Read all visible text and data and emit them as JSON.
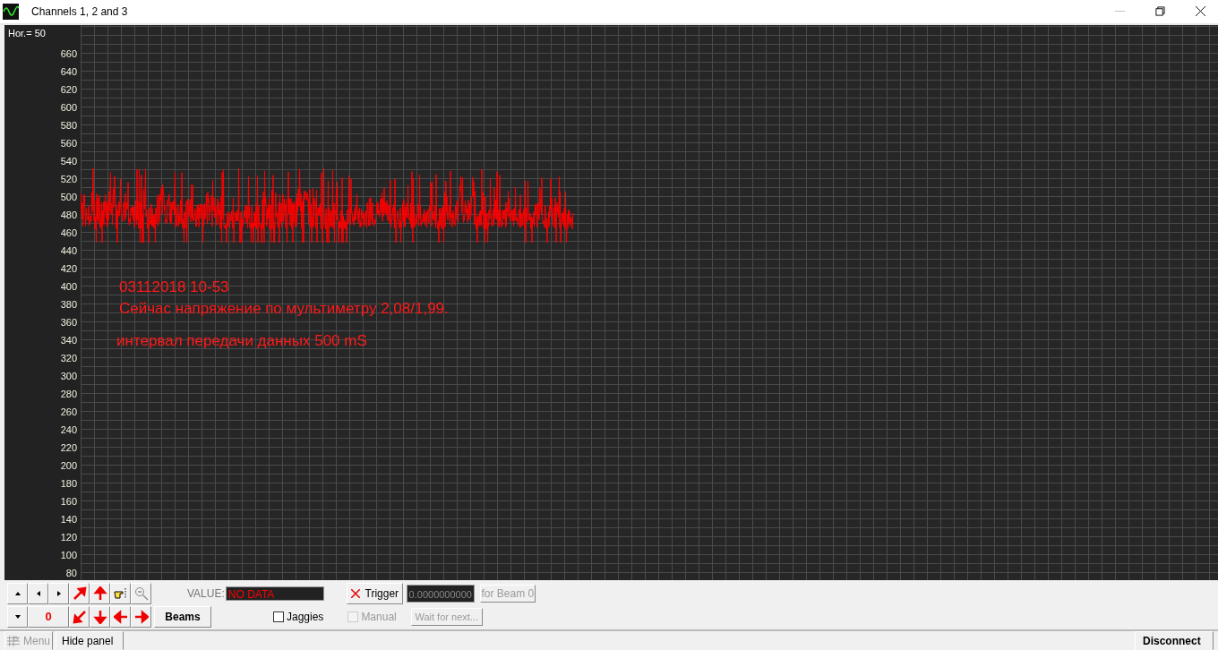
{
  "window": {
    "title": "Channels 1, 2 and 3"
  },
  "plot": {
    "hor_label": "Hor.=",
    "hor_value": "50",
    "y_labels": [
      "660",
      "640",
      "620",
      "600",
      "580",
      "560",
      "540",
      "520",
      "500",
      "480",
      "460",
      "440",
      "420",
      "400",
      "380",
      "360",
      "340",
      "320",
      "300",
      "280",
      "260",
      "240",
      "220",
      "200",
      "180",
      "160",
      "140",
      "120",
      "100",
      "80"
    ],
    "notes": [
      "03112018 10-53",
      "Сейчас напряжение по мультиметру 2,08/1,99.",
      "интервал передачи данных 500 mS"
    ]
  },
  "panel": {
    "counter": "0",
    "beams_button": "Beams",
    "value_label": "VALUE:",
    "value": "NO DATA",
    "trigger_button": "Trigger",
    "trigger_value": "0.0000000000",
    "for_beam_button": {
      "label": "for Beam 0",
      "disabled": true
    },
    "jaggies": {
      "label": "Jaggies",
      "checked": false
    },
    "manual": {
      "label": "Manual",
      "checked": false,
      "disabled": true
    },
    "wait_button": {
      "label": "Wait for next...",
      "disabled": true
    }
  },
  "bottom_bar": {
    "menu_button": {
      "label": "Menu",
      "disabled": true
    },
    "hide_panel_button": "Hide panel",
    "disconnect_button": "Disconnect"
  }
}
